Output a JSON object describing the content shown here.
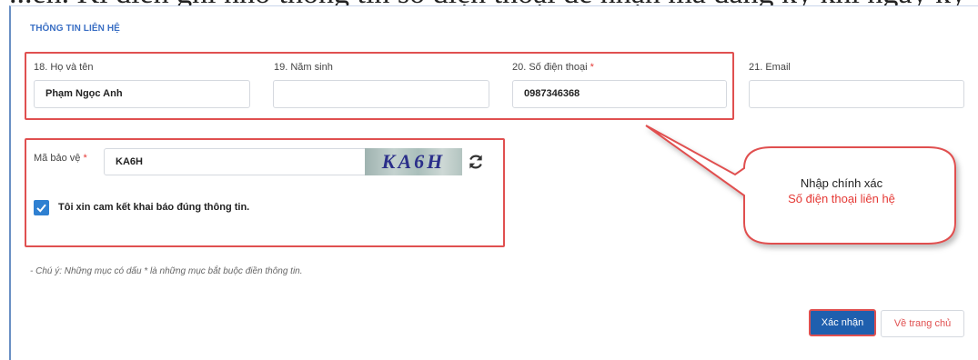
{
  "top_text": "...ễn. Ki điền ghi nhớ thông tin số điện thoại để nhận mã đăng ký khi ngày ký xây dựng...",
  "section_title": "THÔNG TIN LIÊN HỆ",
  "fields": [
    {
      "label": "18. Họ và tên",
      "value": "Phạm Ngọc Anh",
      "required": false
    },
    {
      "label": "19. Năm sinh",
      "value": "",
      "required": false
    },
    {
      "label": "20. Số điện thoại",
      "value": "0987346368",
      "required": true
    },
    {
      "label": "21. Email",
      "value": "",
      "required": false
    }
  ],
  "captcha": {
    "label": "Mã bảo vệ",
    "required_mark": "*",
    "value": "KA6H",
    "image_text": "KA6H",
    "refresh_icon": "refresh-icon"
  },
  "commitment": {
    "checked": true,
    "label": "Tôi xin cam kết khai báo đúng thông tin."
  },
  "note": "- Chú ý: Những mục có dấu * là những mục bắt buộc điền thông tin.",
  "buttons": {
    "confirm": "Xác nhận",
    "home": "Về trang chủ"
  },
  "callout": {
    "line1": "Nhập chính xác",
    "line2": "Số điện thoại liên hệ"
  },
  "colors": {
    "accent": "#1f5fae",
    "highlight": "#e05050",
    "title": "#3a6fc4",
    "required": "#e53935"
  }
}
